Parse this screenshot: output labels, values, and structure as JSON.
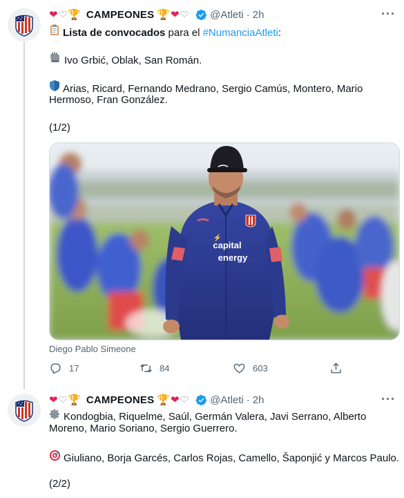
{
  "tweet1": {
    "account_name": "CAMPEONES",
    "handle": "@Atleti",
    "dot": "·",
    "time": "2h",
    "more": "···",
    "list_title": "Lista de convocados",
    "list_mid": "para el",
    "hashtag": "#NumanciaAtleti",
    "colon": ":",
    "goalkeepers": "Ivo Grbić, Oblak, San Román.",
    "defenders_line1": "Arias, Ricard, Fernando Medrano, Sergio Camús, Montero, Mario",
    "defenders_line2": "Hermoso, Fran González.",
    "counter": "(1/2)",
    "media_caption": "Diego Pablo Simeone",
    "shirt_text_1": "capital",
    "shirt_text_2": "energy",
    "replies": "17",
    "retweets": "84",
    "likes": "603"
  },
  "tweet2": {
    "account_name": "CAMPEONES",
    "handle": "@Atleti",
    "dot": "·",
    "time": "2h",
    "more": "···",
    "midfielders_line1": "Kondogbia, Riquelme, Saúl, Germán Valera, Javi Serrano, Alberto",
    "midfielders_line2": "Moreno, Mario Soriano, Sergio Guerrero.",
    "forwards": "Giuliano, Borja Garcés, Carlos Rojas, Camello, Šaponjić y Marcos Paulo.",
    "counter": "(2/2)"
  },
  "icons": {
    "avatar": "atletico-crest-icon",
    "verified": "verified-badge-icon",
    "clipboard": "clipboard-icon",
    "gloves": "gloves-icon",
    "shield": "shield-icon",
    "gear": "gear-icon",
    "target": "target-icon",
    "reply": "reply-icon",
    "retweet": "retweet-icon",
    "like": "heart-icon",
    "share": "share-icon"
  },
  "colors": {
    "hashtag": "#1d9bf0",
    "verified": "#1d9bf0",
    "muted": "#536471",
    "heart": "#e0245e",
    "kit_blue": "#2b3a8c"
  }
}
